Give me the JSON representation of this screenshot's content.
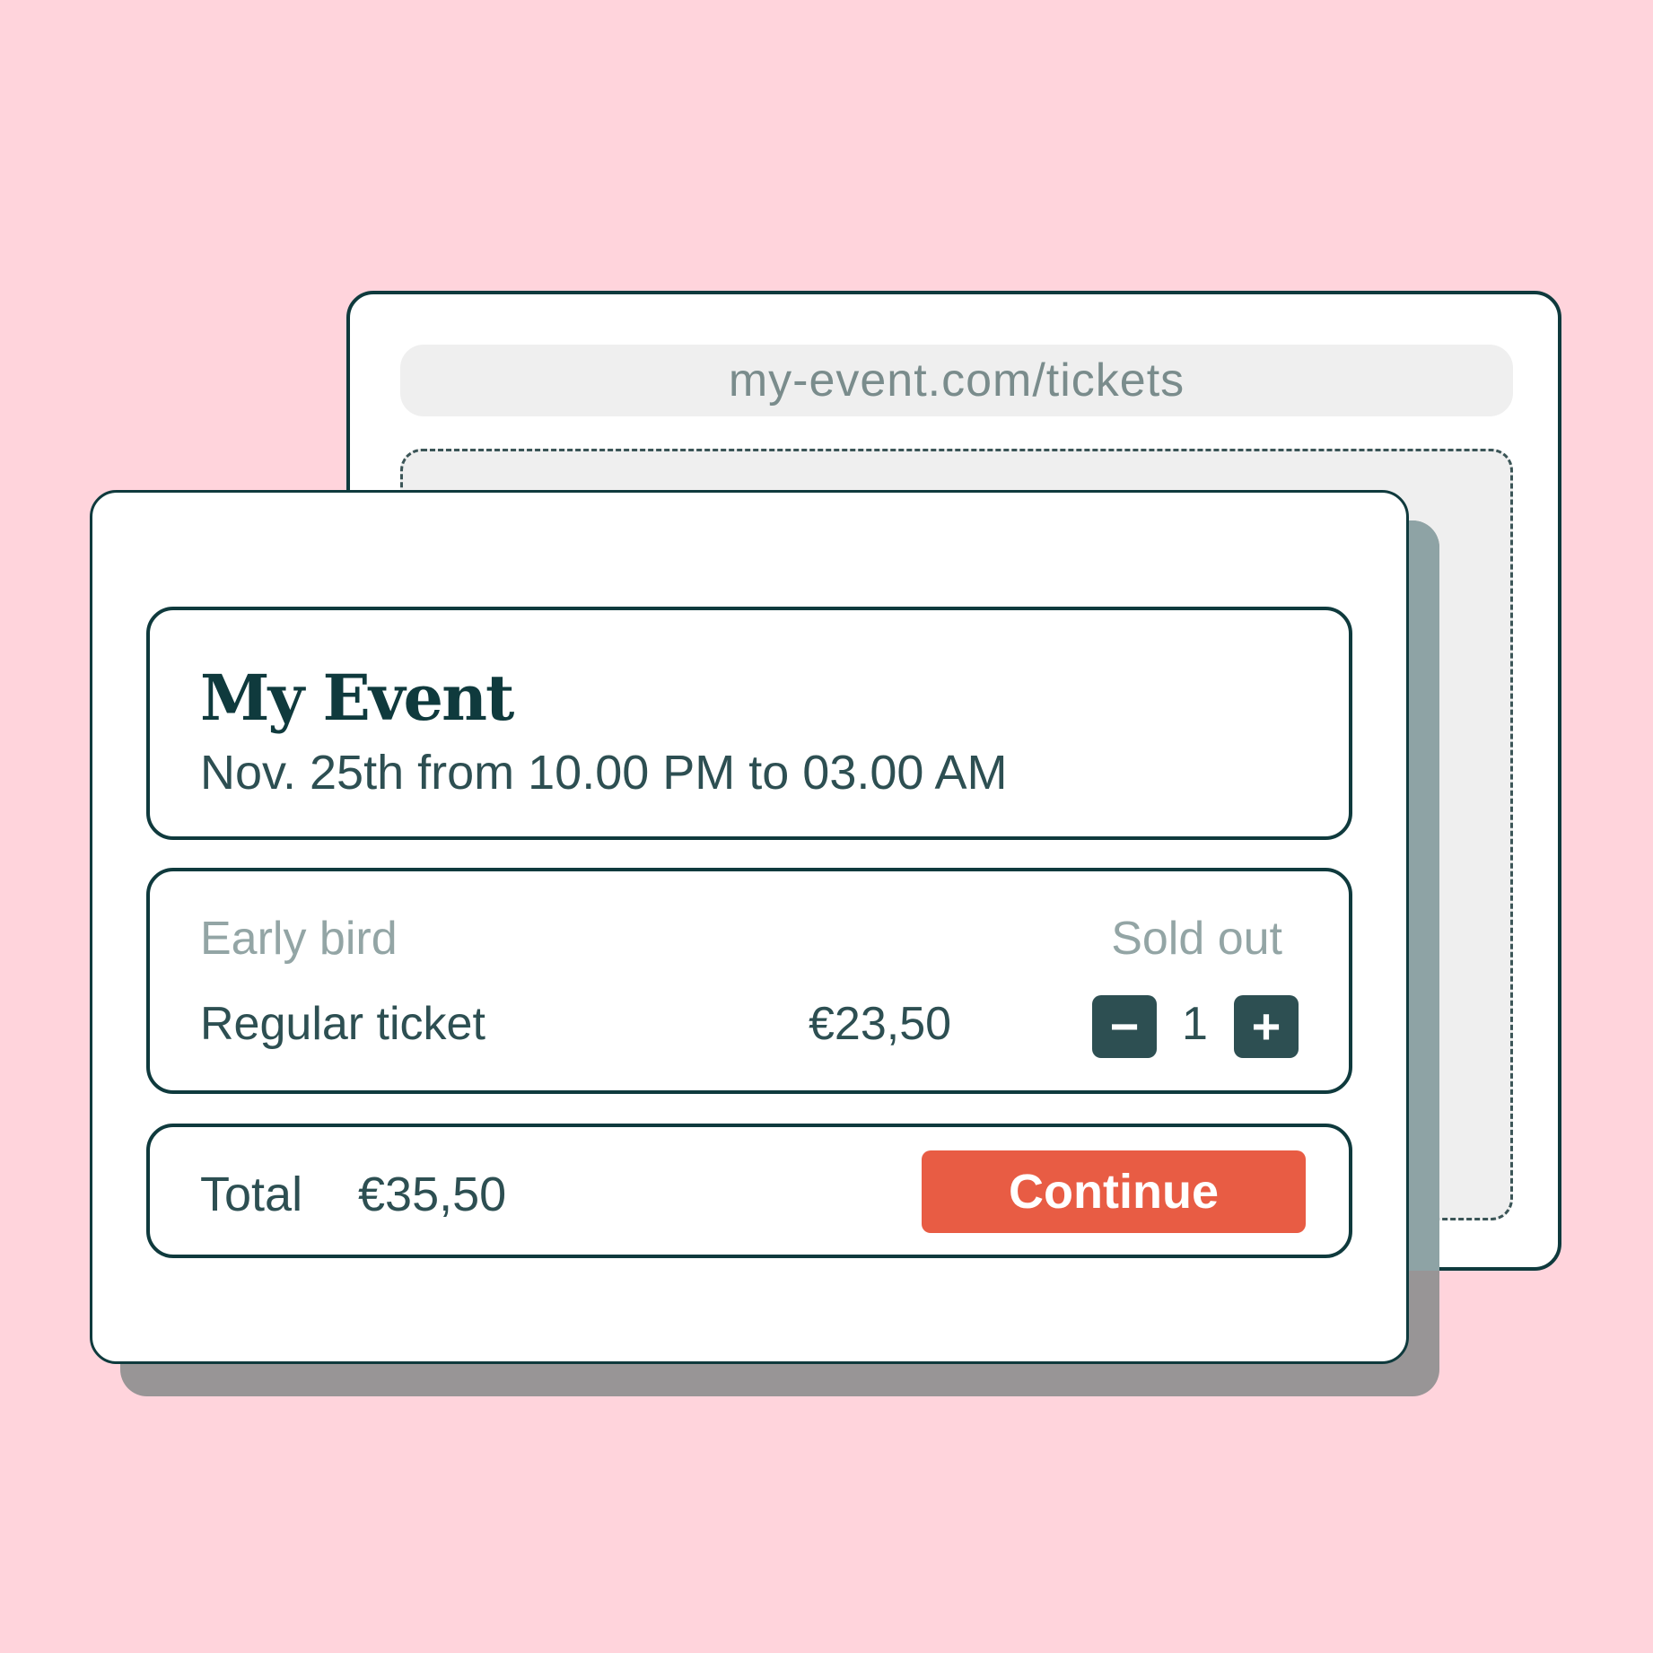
{
  "browser": {
    "url": "my-event.com/tickets"
  },
  "event": {
    "title": "My Event",
    "date": "Nov. 25th from 10.00 PM to 03.00 AM"
  },
  "tickets": {
    "early_bird": {
      "label": "Early bird",
      "status": "Sold out"
    },
    "regular": {
      "label": "Regular ticket",
      "price": "€23,50",
      "quantity": "1",
      "decrement_label": "−",
      "increment_label": "+"
    }
  },
  "checkout": {
    "total_label": "Total",
    "total_amount": "€35,50",
    "continue_label": "Continue"
  },
  "colors": {
    "background": "#ffd4dc",
    "primary_dark": "#0f3a3d",
    "text": "#2d4f52",
    "muted": "#93a5a5",
    "accent": "#e85c44"
  }
}
